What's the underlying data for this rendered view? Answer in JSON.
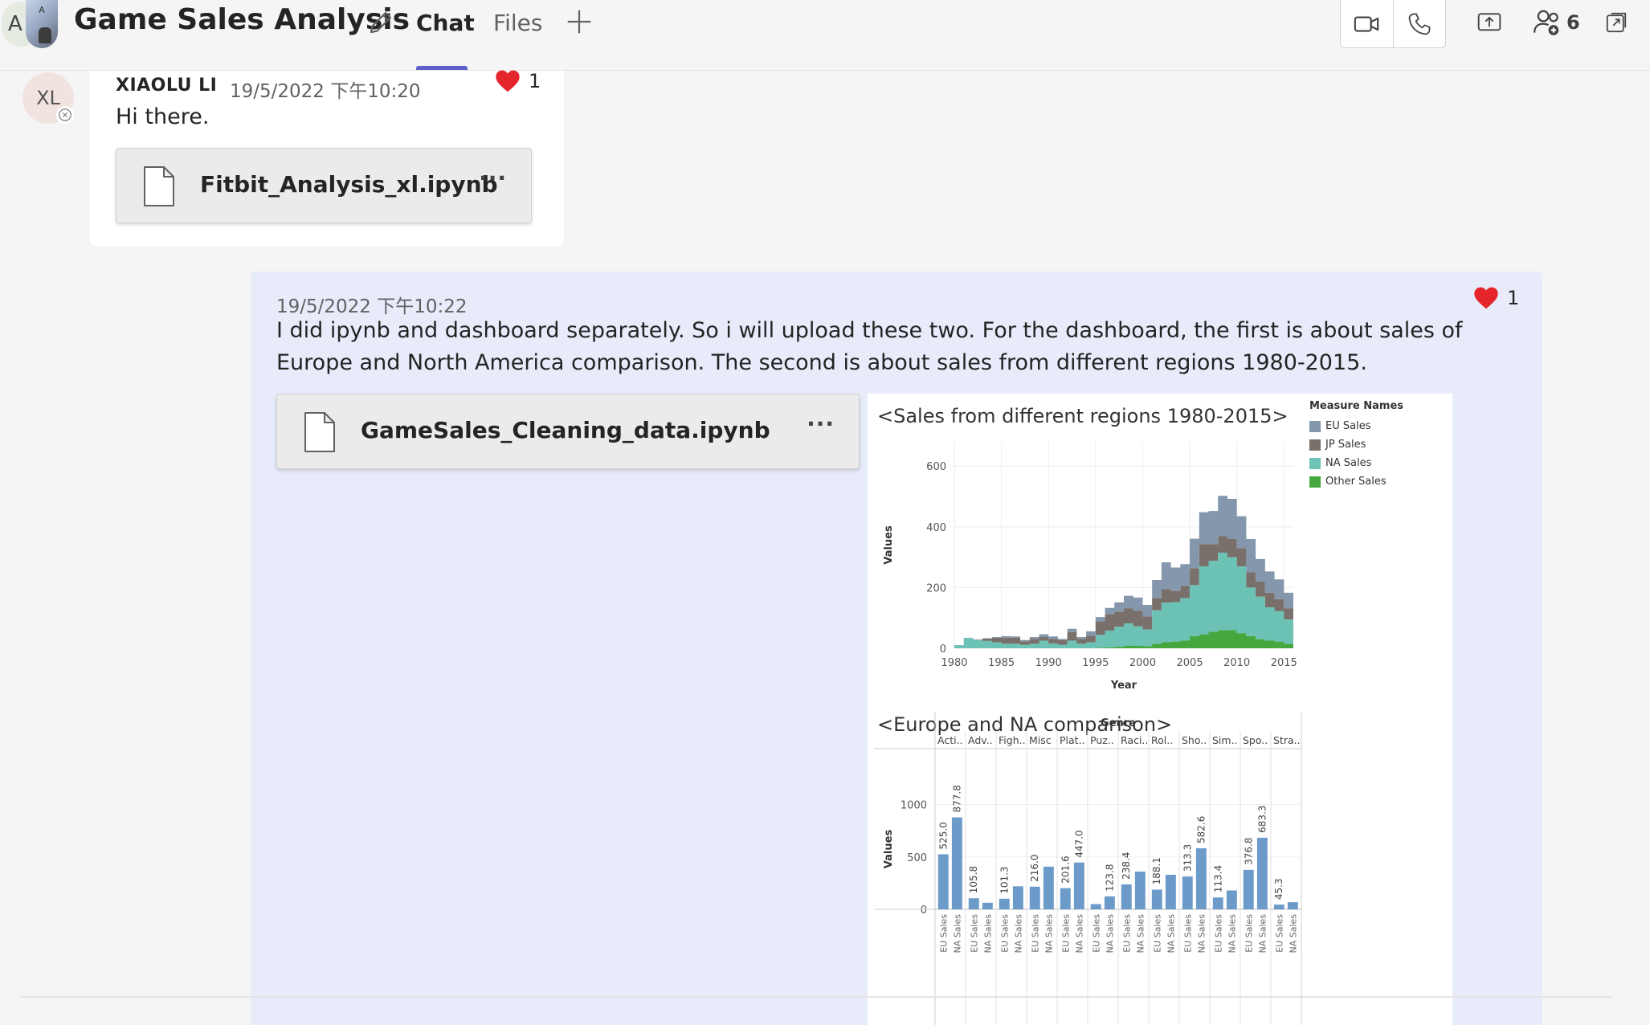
{
  "header": {
    "avatars": [
      {
        "initial": "A"
      },
      {
        "initial": "A"
      }
    ],
    "title": "Game Sales Analysis",
    "tabs": [
      {
        "label": "Chat",
        "active": true
      },
      {
        "label": "Files",
        "active": false
      }
    ],
    "people_count": "6",
    "accent_color": "#5b5fc7"
  },
  "messages": [
    {
      "avatar_initials": "XL",
      "sender": "XIAOLU LI",
      "timestamp": "19/5/2022 下午10:20",
      "reaction_count": "1",
      "text": "Hi there.",
      "attachment": {
        "name": "Fitbit_Analysis_xl.ipynb",
        "more": "···"
      }
    },
    {
      "timestamp": "19/5/2022 下午10:22",
      "reaction_count": "1",
      "text": "I did ipynb and dashboard separately. So i will upload these two. For the dashboard, the first is about sales of Europe and North America comparison. The second is about sales from different regions 1980-2015.",
      "attachment": {
        "name": "GameSales_Cleaning_data.ipynb",
        "more": "···"
      }
    }
  ],
  "dashboard": {
    "chart1_title": "<Sales from different regions 1980-2015>",
    "chart2_title": "<Europe and NA comparison>"
  },
  "chart_data": [
    {
      "type": "area",
      "title": "<Sales from different regions 1980-2015>",
      "xlabel": "Year",
      "ylabel": "Values",
      "xlim": [
        1980,
        2016
      ],
      "ylim": [
        0,
        680
      ],
      "xticks": [
        1980,
        1985,
        1990,
        1995,
        2000,
        2005,
        2010,
        2015
      ],
      "yticks": [
        0,
        200,
        400,
        600
      ],
      "legend_title": "Measure Names",
      "legend_position": "top-right",
      "x": [
        1980,
        1981,
        1982,
        1983,
        1984,
        1985,
        1986,
        1987,
        1988,
        1989,
        1990,
        1991,
        1992,
        1993,
        1994,
        1995,
        1996,
        1997,
        1998,
        1999,
        2000,
        2001,
        2002,
        2003,
        2004,
        2005,
        2006,
        2007,
        2008,
        2009,
        2010,
        2011,
        2012,
        2013,
        2014,
        2015
      ],
      "series": [
        {
          "name": "EU Sales",
          "color": "#8497ac",
          "values": [
            0.5,
            1,
            2,
            1,
            2,
            5,
            4,
            4,
            6,
            9,
            8,
            4,
            11,
            6,
            14,
            14,
            20,
            30,
            41,
            43,
            38,
            60,
            88,
            77,
            72,
            97,
            105,
            109,
            132,
            132,
            105,
            110,
            74,
            70,
            65,
            52
          ]
        },
        {
          "name": "JP Sales",
          "color": "#7a706b",
          "values": [
            0,
            0,
            0,
            8,
            15,
            20,
            20,
            11,
            16,
            12,
            15,
            15,
            28,
            16,
            22,
            45,
            55,
            50,
            50,
            52,
            43,
            40,
            45,
            37,
            40,
            56,
            73,
            55,
            55,
            60,
            60,
            50,
            50,
            48,
            40,
            36
          ]
        },
        {
          "name": "NA Sales",
          "color": "#6cc2b5",
          "values": [
            10,
            33,
            27,
            24,
            20,
            15,
            15,
            12,
            15,
            25,
            16,
            12,
            25,
            15,
            20,
            42,
            55,
            66,
            74,
            64,
            55,
            110,
            130,
            130,
            140,
            168,
            225,
            233,
            255,
            240,
            220,
            160,
            140,
            110,
            100,
            80
          ]
        },
        {
          "name": "Other Sales",
          "color": "#45a83f",
          "values": [
            0,
            0,
            0,
            0,
            0,
            0,
            0,
            0,
            0,
            0,
            0,
            0,
            0,
            0,
            0,
            2,
            3,
            5,
            8,
            8,
            7,
            15,
            20,
            22,
            25,
            40,
            45,
            55,
            60,
            60,
            50,
            40,
            30,
            25,
            22,
            15
          ]
        }
      ]
    },
    {
      "type": "bar",
      "title": "<Europe and NA comparison>",
      "xlabel": "Genre",
      "ylabel": "Values",
      "ylim": [
        0,
        1150
      ],
      "yticks": [
        0,
        500,
        1000
      ],
      "categories": [
        "Acti..",
        "Adv..",
        "Figh..",
        "Misc",
        "Plat..",
        "Puz..",
        "Raci..",
        "Rol..",
        "Sho..",
        "Sim..",
        "Spo..",
        "Stra.."
      ],
      "sub_labels": [
        "EU Sales",
        "NA Sales"
      ],
      "series": [
        {
          "name": "EU Sales",
          "color": "#6d9bc9",
          "values": [
            525.0,
            105.8,
            101.3,
            216.0,
            201.6,
            50.0,
            238.4,
            188.1,
            313.3,
            113.4,
            376.8,
            45.3
          ]
        },
        {
          "name": "NA Sales",
          "color": "#6d9bc9",
          "values": [
            877.8,
            63.0,
            220.0,
            407.0,
            447.0,
            123.8,
            360.0,
            330.0,
            582.6,
            180.0,
            683.3,
            68.0
          ]
        }
      ],
      "data_labels": [
        "525.0",
        "877.8",
        "105.8",
        "101.3",
        "216.0",
        "201.6",
        "447.0",
        "123.8",
        "238.4",
        "188.1",
        "313.3",
        "582.6",
        "113.4",
        "376.8",
        "683.3",
        "45.3"
      ]
    }
  ]
}
